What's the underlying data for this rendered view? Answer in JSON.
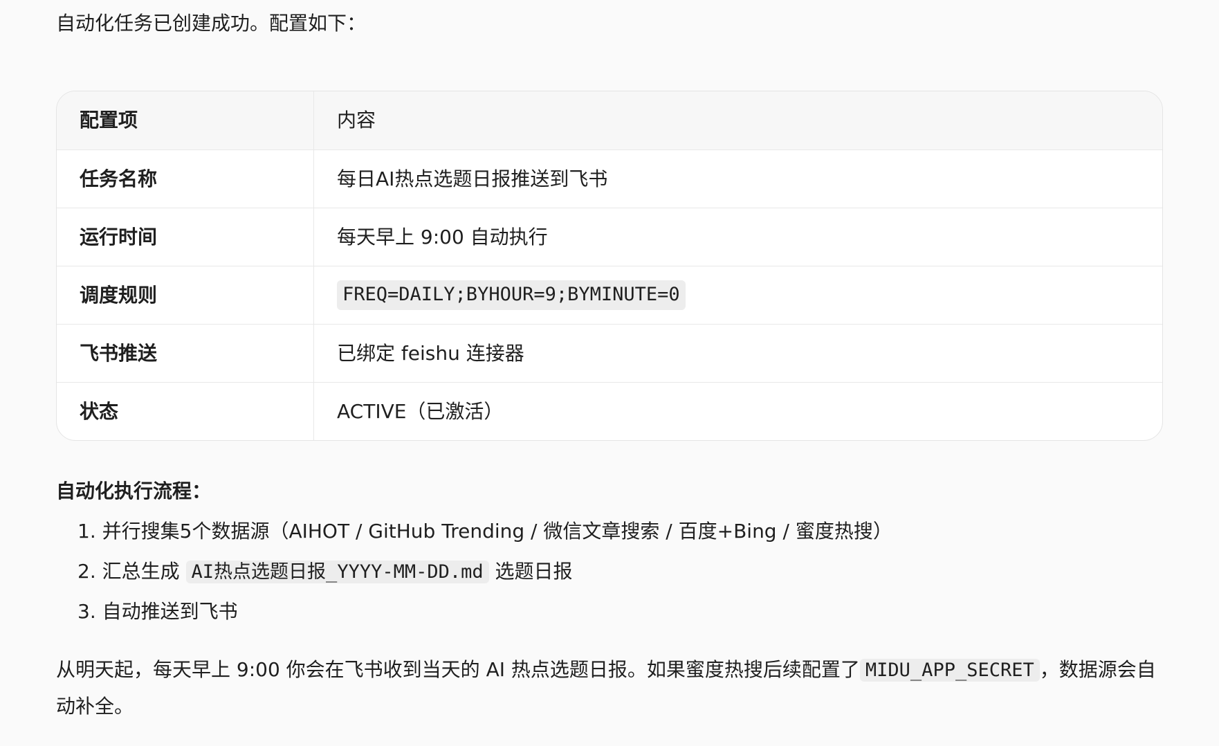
{
  "intro": "自动化任务已创建成功。配置如下：",
  "table": {
    "header": {
      "key": "配置项",
      "value": "内容"
    },
    "rows": [
      {
        "key": "任务名称",
        "value": "每日AI热点选题日报推送到飞书"
      },
      {
        "key": "运行时间",
        "value": "每天早上 9:00 自动执行"
      },
      {
        "key": "调度规则",
        "value": "FREQ=DAILY;BYHOUR=9;BYMINUTE=0"
      },
      {
        "key": "飞书推送",
        "value": "已绑定 feishu 连接器"
      },
      {
        "key": "状态",
        "value": "ACTIVE（已激活）"
      }
    ]
  },
  "flow": {
    "title": "自动化执行流程：",
    "steps": [
      {
        "num": "1.",
        "text": "并行搜集5个数据源（AIHOT / GitHub Trending / 微信文章搜索 / 百度+Bing / 蜜度热搜）"
      },
      {
        "num": "2.",
        "before": "汇总生成",
        "code": "AI热点选题日报_YYYY-MM-DD.md",
        "after": "选题日报"
      },
      {
        "num": "3.",
        "text": "自动推送到飞书"
      }
    ]
  },
  "outro": {
    "before": "从明天起，每天早上 9:00 你会在飞书收到当天的 AI 热点选题日报。如果蜜度热搜后续配置了",
    "code": "MIDU_APP_SECRET",
    "after": "，数据源会自动补全。"
  }
}
